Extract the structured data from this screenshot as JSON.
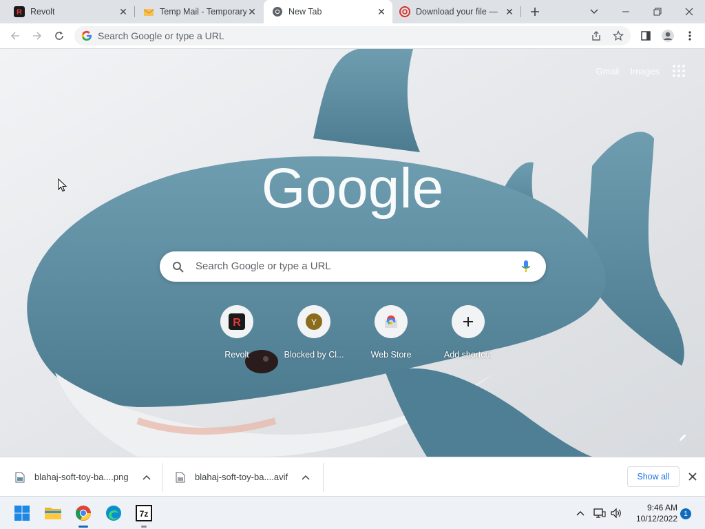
{
  "browser": {
    "tabs": [
      {
        "title": "Revolt",
        "favicon": "revolt-icon",
        "active": false
      },
      {
        "title": "Temp Mail - Temporary",
        "favicon": "tempmail-icon",
        "active": false
      },
      {
        "title": "New Tab",
        "favicon": "chrome-icon",
        "active": true
      },
      {
        "title": "Download your file — ",
        "favicon": "download-site-icon",
        "active": false
      }
    ],
    "omnibox_placeholder": "Search Google or type a URL"
  },
  "ntp": {
    "top_links": {
      "gmail": "Gmail",
      "images": "Images"
    },
    "logo_text": "Google",
    "search_placeholder": "Search Google or type a URL",
    "shortcuts": [
      {
        "label": "Revolt",
        "icon_letter": "R"
      },
      {
        "label": "Blocked by Cl...",
        "icon_letter": "Y"
      },
      {
        "label": "Web Store",
        "icon_letter": ""
      },
      {
        "label": "Add shortcut",
        "icon_letter": "+"
      }
    ]
  },
  "downloads": {
    "items": [
      {
        "filename": "blahaj-soft-toy-ba....png"
      },
      {
        "filename": "blahaj-soft-toy-ba....avif"
      }
    ],
    "show_all": "Show all"
  },
  "taskbar": {
    "time": "9:46 AM",
    "date": "10/12/2022",
    "notifications": "1",
    "app_7zip_label": "7z"
  },
  "colors": {
    "tab_strip": "#dee1e6",
    "accent_blue": "#1a73e8",
    "shark": "#5f8fa3",
    "revolt_red": "#e23b3b"
  }
}
